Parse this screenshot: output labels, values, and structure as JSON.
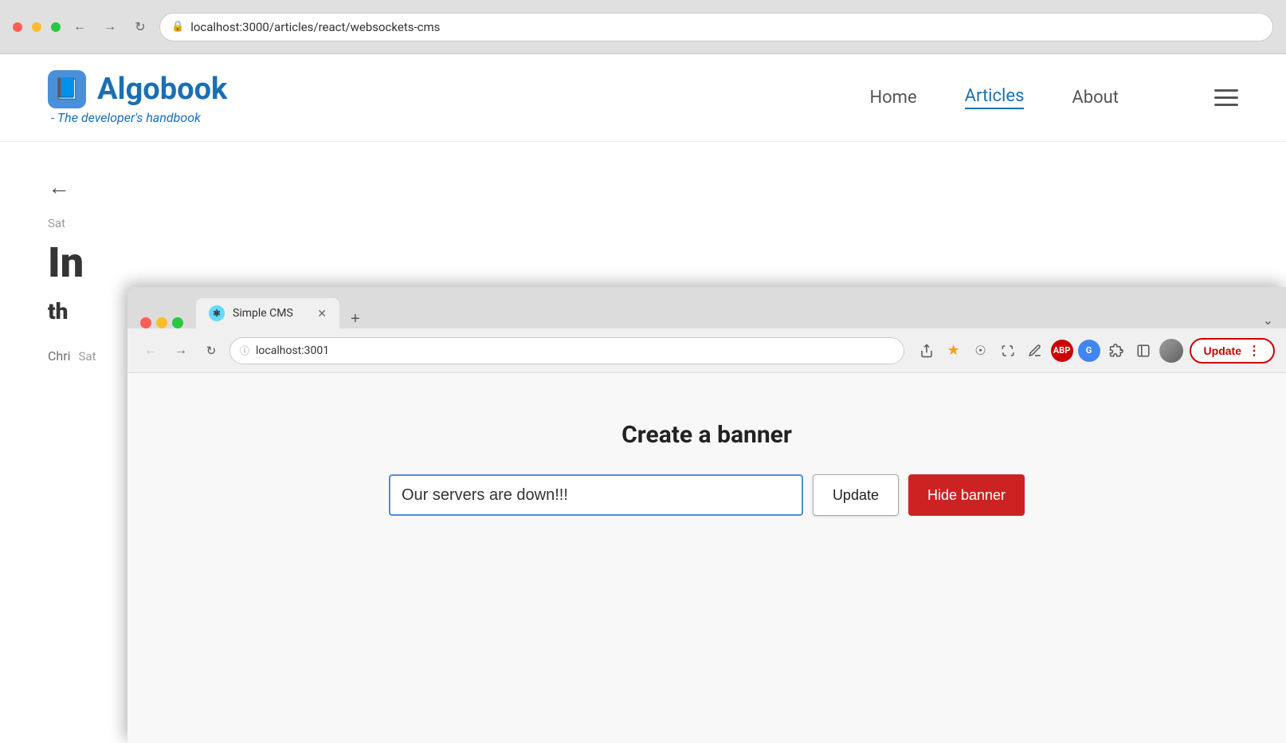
{
  "outer_browser": {
    "address": "localhost:3000/articles/react/websockets-cms",
    "lock_icon": "🔒"
  },
  "algobook": {
    "logo_emoji": "📘",
    "title": "Algobook",
    "subtitle": "- The developer's handbook",
    "nav": {
      "home": "Home",
      "articles": "Articles",
      "about": "About"
    },
    "article": {
      "date": "Sat",
      "title_partial": "In",
      "body_partial": "th",
      "author": "Chri",
      "author_date": "Sat"
    }
  },
  "overlay_browser": {
    "tab_label": "Simple CMS",
    "tab_icon": "⚛",
    "address": "localhost:3001",
    "abp_label": "ABP",
    "google_label": "G",
    "update_label": "Update",
    "update_dots": "⋮"
  },
  "cms": {
    "title": "Create a banner",
    "input_value": "Our servers are down!!!",
    "update_button": "Update",
    "hide_button": "Hide banner"
  }
}
